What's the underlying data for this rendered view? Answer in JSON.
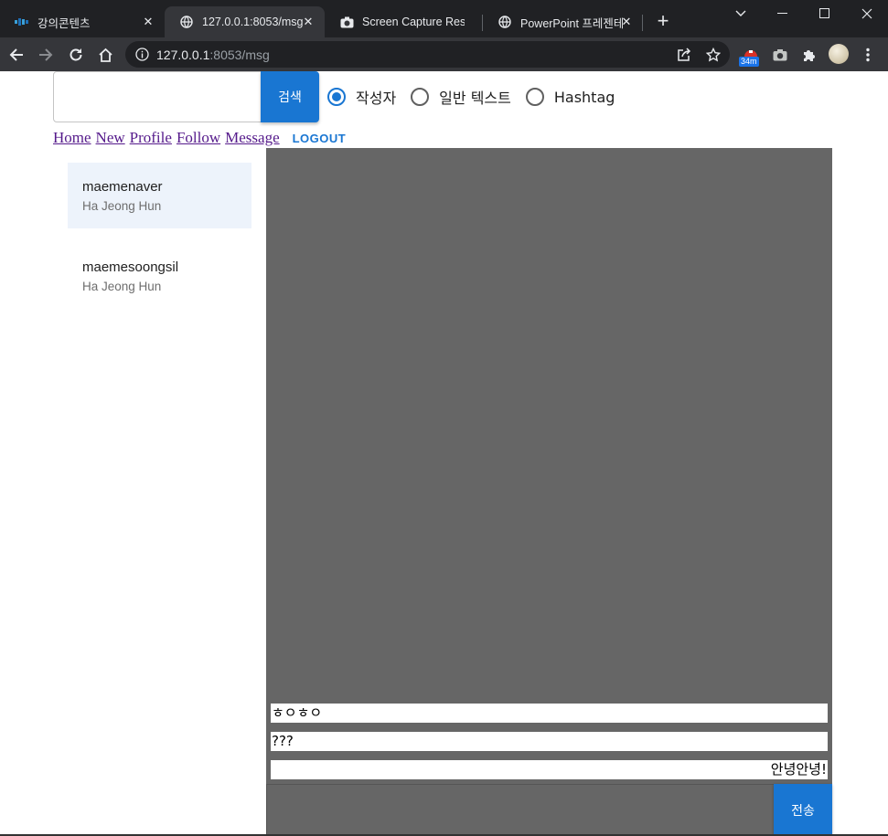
{
  "browser": {
    "tabs": [
      {
        "title": "강의콘텐츠",
        "icon": "site-favicon",
        "active": false
      },
      {
        "title": "127.0.0.1:8053/msg",
        "icon": "globe-icon",
        "active": true
      },
      {
        "title": "Screen Capture Resu",
        "icon": "camera-icon",
        "active": false
      },
      {
        "title": "PowerPoint 프레젠테",
        "icon": "globe-icon",
        "active": false
      }
    ],
    "address": {
      "host": "127.0.0.1",
      "rest": ":8053/msg"
    },
    "extension_badge": "34m"
  },
  "search": {
    "input_value": "",
    "button_label": "검색",
    "options": [
      {
        "label": "작성자",
        "checked": true
      },
      {
        "label": "일반 텍스트",
        "checked": false
      },
      {
        "label": "Hashtag",
        "checked": false
      }
    ]
  },
  "nav": {
    "links": [
      "Home",
      "New",
      "Profile",
      "Follow",
      "Message"
    ],
    "logout": "LOGOUT"
  },
  "conversations": [
    {
      "username": "maemenaver",
      "display_name": "Ha Jeong Hun",
      "selected": true
    },
    {
      "username": "maemesoongsil",
      "display_name": "Ha Jeong Hun",
      "selected": false
    }
  ],
  "messages": [
    {
      "text": "ㅎㅇㅎㅇ",
      "mine": false
    },
    {
      "text": "???",
      "mine": false
    },
    {
      "text": "안녕안녕!",
      "mine": true
    }
  ],
  "composer": {
    "value": "",
    "send_label": "전송"
  },
  "colors": {
    "accent": "#1976d2",
    "chat_bg": "#666666",
    "selected_row": "#edf3fb",
    "link_visited": "#551a8b"
  }
}
